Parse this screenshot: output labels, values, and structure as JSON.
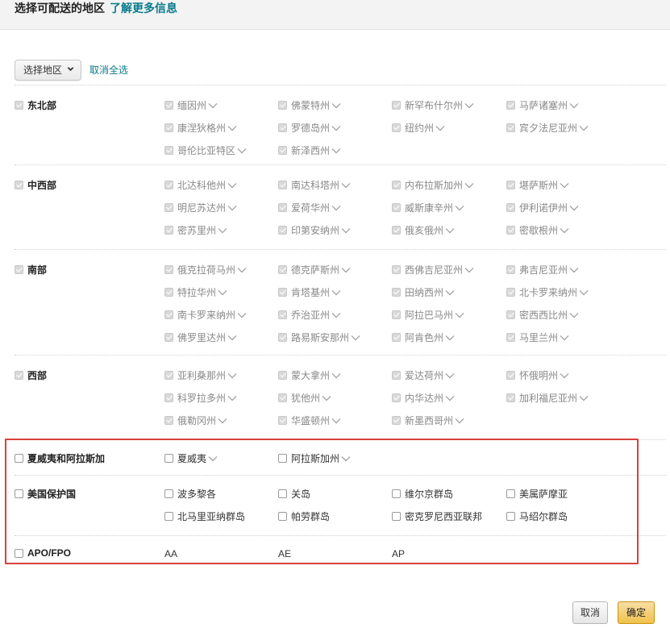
{
  "header": {
    "title": "选择可配送的地区",
    "learn_more": "了解更多信息"
  },
  "toolbar": {
    "select_label": "选择地区",
    "deselect_all": "取消全选"
  },
  "regions": {
    "northeast": {
      "name": "东北部",
      "states": [
        "缅因州",
        "佛蒙特州",
        "新罕布什尔州",
        "马萨诸塞州",
        "康涅狄格州",
        "罗德岛州",
        "纽约州",
        "宾夕法尼亚州",
        "哥伦比亚特区",
        "新泽西州"
      ]
    },
    "midwest": {
      "name": "中西部",
      "states": [
        "北达科他州",
        "南达科塔州",
        "内布拉斯加州",
        "堪萨斯州",
        "明尼苏达州",
        "爱荷华州",
        "威斯康辛州",
        "伊利诺伊州",
        "密苏里州",
        "印第安纳州",
        "俄亥俄州",
        "密歇根州"
      ]
    },
    "south": {
      "name": "南部",
      "states": [
        "俄克拉荷马州",
        "德克萨斯州",
        "西佛吉尼亚州",
        "弗吉尼亚州",
        "特拉华州",
        "肯塔基州",
        "田纳西州",
        "北卡罗来纳州",
        "南卡罗来纳州",
        "乔治亚州",
        "阿拉巴马州",
        "密西西比州",
        "佛罗里达州",
        "路易斯安那州",
        "阿肯色州",
        "马里兰州"
      ]
    },
    "west": {
      "name": "西部",
      "states": [
        "亚利桑那州",
        "蒙大拿州",
        "爱达荷州",
        "怀俄明州",
        "科罗拉多州",
        "犹他州",
        "内华达州",
        "加利福尼亚州",
        "俄勒冈州",
        "华盛顿州",
        "新墨西哥州"
      ]
    },
    "hawaii_alaska": {
      "name": "夏威夷和阿拉斯加",
      "states": [
        "夏威夷",
        "阿拉斯加州"
      ]
    },
    "protectorates": {
      "name": "美国保护国",
      "states": [
        "波多黎各",
        "关岛",
        "维尔京群岛",
        "美属萨摩亚",
        "北马里亚纳群岛",
        "帕劳群岛",
        "密克罗尼西亚联邦",
        "马绍尔群岛"
      ]
    },
    "apo": {
      "name": "APO/FPO",
      "codes": [
        "AA",
        "AE",
        "AP"
      ]
    }
  },
  "footer": {
    "cancel": "取消",
    "confirm": "确定"
  },
  "colors": {
    "link": "#0a7b8c",
    "highlight": "#d9413b",
    "confirm": "#f0c14b"
  }
}
